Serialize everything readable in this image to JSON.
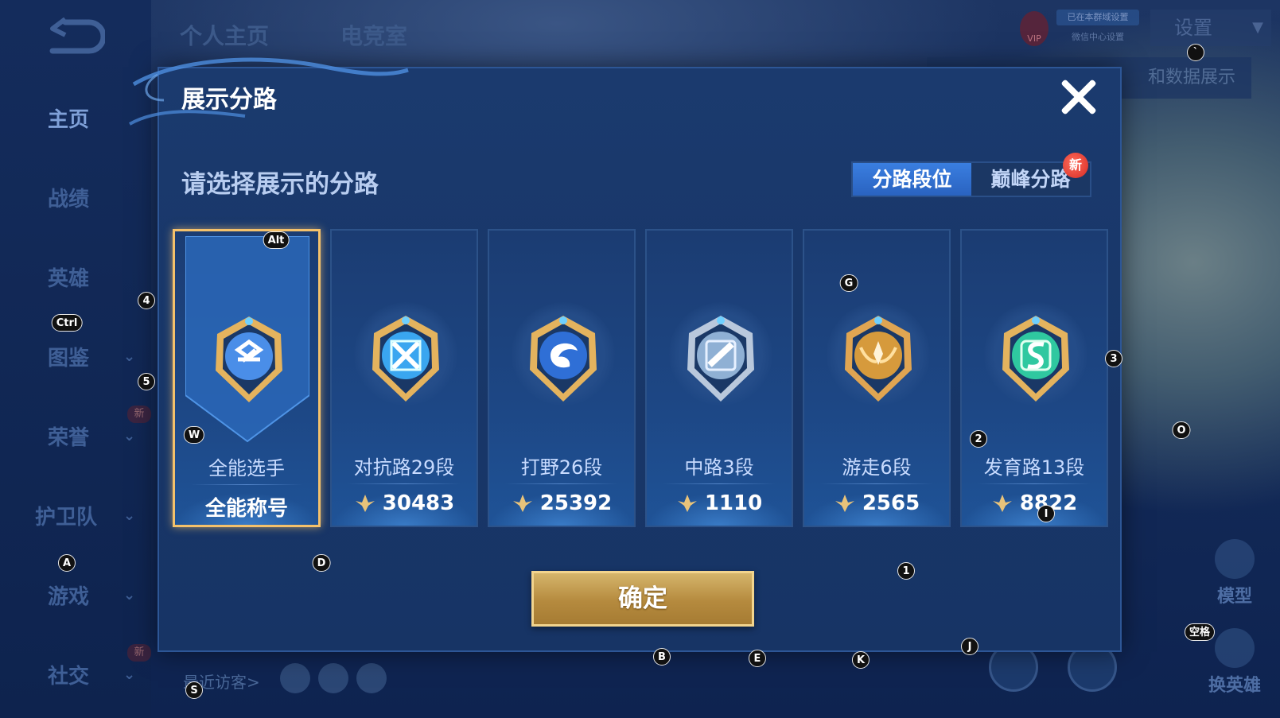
{
  "sidebar": {
    "items": [
      {
        "label": "主页",
        "active": true,
        "chevron": false,
        "new": false
      },
      {
        "label": "战绩",
        "active": false,
        "chevron": false,
        "new": false
      },
      {
        "label": "英雄",
        "active": false,
        "chevron": false,
        "new": false
      },
      {
        "label": "图鉴",
        "active": false,
        "chevron": true,
        "new": false
      },
      {
        "label": "荣誉",
        "active": false,
        "chevron": true,
        "new": true
      },
      {
        "label": "护卫队",
        "active": false,
        "chevron": true,
        "new": false
      },
      {
        "label": "游戏",
        "active": false,
        "chevron": true,
        "new": false
      },
      {
        "label": "社交",
        "active": false,
        "chevron": true,
        "new": true
      }
    ],
    "new_badge": "新"
  },
  "top_tabs": [
    "个人主页",
    "电竞室"
  ],
  "settings_label": "设置",
  "behind_bar_text": "和数据展示",
  "vip": {
    "icon": "VIP",
    "tag1": "已在本群域设置",
    "tag2": "微信中心设置"
  },
  "right_actions": [
    {
      "label": "模型"
    },
    {
      "label": "换英雄"
    }
  ],
  "recent_visitors_label": "最近访客>",
  "modal": {
    "title": "展示分路",
    "prompt": "请选择展示的分路",
    "toggle": {
      "options": [
        "分路段位",
        "巅峰分路"
      ],
      "selected": 0,
      "new_badge": "新"
    },
    "cards": [
      {
        "name": "全能选手",
        "score": "全能称号",
        "selected": true,
        "emblem": "allround-emblem",
        "color": "#4a8ee8"
      },
      {
        "name": "对抗路29段",
        "score": "30483",
        "selected": false,
        "emblem": "clash-lane-emblem",
        "color": "#3aa6f0"
      },
      {
        "name": "打野26段",
        "score": "25392",
        "selected": false,
        "emblem": "jungle-emblem",
        "color": "#2f6fd6"
      },
      {
        "name": "中路3段",
        "score": "1110",
        "selected": false,
        "emblem": "mid-lane-emblem",
        "color": "#8fb0d4"
      },
      {
        "name": "游走6段",
        "score": "2565",
        "selected": false,
        "emblem": "roam-emblem",
        "color": "#d69a3c"
      },
      {
        "name": "发育路13段",
        "score": "8822",
        "selected": false,
        "emblem": "farm-lane-emblem",
        "color": "#2fc8a0"
      }
    ],
    "confirm_label": "确定"
  },
  "key_hints": [
    {
      "key": "Alt"
    },
    {
      "key": "4"
    },
    {
      "key": "Ctrl"
    },
    {
      "key": "5"
    },
    {
      "key": "W"
    },
    {
      "key": "A"
    },
    {
      "key": "D"
    },
    {
      "key": "S"
    },
    {
      "key": "G"
    },
    {
      "key": "3"
    },
    {
      "key": "2"
    },
    {
      "key": "O"
    },
    {
      "key": "I"
    },
    {
      "key": "1"
    },
    {
      "key": "J"
    },
    {
      "key": "B"
    },
    {
      "key": "E"
    },
    {
      "key": "K"
    },
    {
      "key": "空格"
    },
    {
      "key": "`"
    }
  ],
  "colors": {
    "accent": "#3a7ee0",
    "gold": "#d5b56b",
    "selected_border": "#f4c16b",
    "new_red": "#d62b24"
  }
}
